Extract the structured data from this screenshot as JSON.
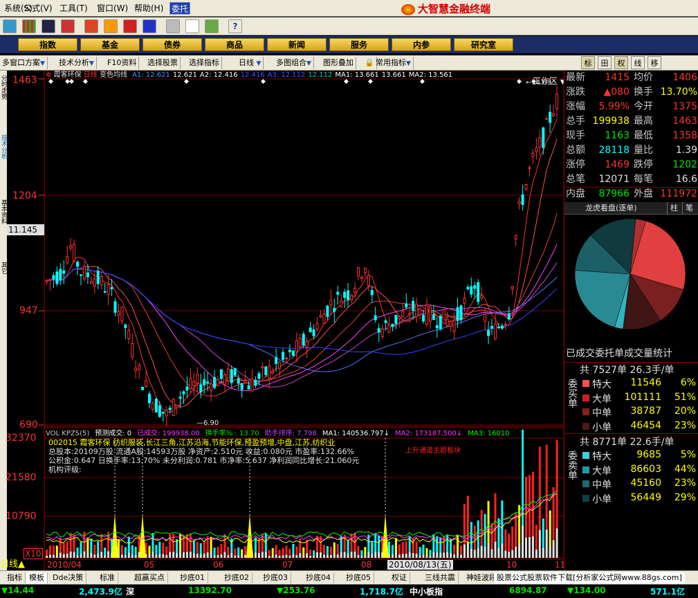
{
  "menu": {
    "items": [
      "系统(S)",
      "公式(V)",
      "工具(T)",
      "窗口(W)",
      "帮助(H)",
      "委托"
    ],
    "brand": "大智慧金融终端"
  },
  "nav": {
    "items": [
      "指数",
      "基金",
      "债券",
      "商品",
      "新闻",
      "服务",
      "内参",
      "研究室"
    ],
    "workspace": "工作区"
  },
  "subbar": {
    "items": [
      "多窗口方案",
      "技术分析",
      "F10资料",
      "选择股票",
      "选择指标",
      "日线",
      "多图组合",
      "图形叠加",
      "常用指标"
    ],
    "right_tabs": [
      "标",
      "田",
      "权",
      "线",
      "移"
    ]
  },
  "left_tabs": [
    "分时走势",
    "技术分析",
    "基本资料",
    "其它"
  ],
  "price_chart": {
    "title": "霞客环保",
    "period": "日线",
    "indicator": "变色均线",
    "legend": [
      {
        "label": "A1:",
        "value": "12.621",
        "color": "#4a90ff"
      },
      {
        "label": "",
        "value": "12.621",
        "color": "#ffffff"
      },
      {
        "label": "A2:",
        "value": "12.416",
        "color": "#ffffff"
      },
      {
        "label": "",
        "value": "12.416",
        "color": "#3a56ff"
      },
      {
        "label": "A3:",
        "value": "12.112",
        "color": "#3a56ff"
      },
      {
        "label": "",
        "value": "12.112",
        "color": "#00c8c8"
      },
      {
        "label": "MA1:",
        "value": "13.661",
        "color": "#ffffff"
      },
      {
        "label": "",
        "value": "13.661",
        "color": "#ffffff"
      },
      {
        "label": "MA2:",
        "value": "13.561",
        "color": "#ffffff"
      }
    ],
    "y_ticks": [
      "1463",
      "1204",
      "947",
      "690"
    ],
    "current_price_label": "11.145",
    "low_label": "6.90",
    "high_label": "14.63"
  },
  "volume_chart": {
    "header": [
      {
        "text": "VOL KPZS(5)",
        "color": "#c8c8c8"
      },
      {
        "text": "预测成交: 0",
        "color": "#ffffff"
      },
      {
        "text": "已成交: 199938.00",
        "color": "#ff33ff"
      },
      {
        "text": "换手率% : 13.70",
        "color": "#00e600"
      },
      {
        "text": "助手排序: 7.798",
        "color": "#c040ff"
      },
      {
        "text": "MA1: 140536.797↓",
        "color": "#ffffff"
      },
      {
        "text": "MA2: 173187.500↓",
        "color": "#ff33ff"
      },
      {
        "text": "MA3: 16010",
        "color": "#00ff00"
      }
    ],
    "info": [
      "002015  霞客环保 纺织服装,长江三角,江苏沿海,节能环保,预盈预增,中盘,江苏,纺织业",
      "总股本:20109万股 流通A股:14593万股  净资产:2.510元  收益:0.080元  市盈率:132.66%",
      "公积金:0.647  日换手率:13.70%  未分利润:0.781  市净率:5.637  净利润同比增长:21.060元",
      "机构评级:"
    ],
    "annotation": "上升通道主题板块",
    "y_ticks": [
      "32370",
      "21580",
      "10790"
    ],
    "multiplier": "X10",
    "x_labels": [
      "2010/04",
      "05",
      "06",
      "07",
      "08",
      "2010/08/13(五)",
      "10",
      "11"
    ]
  },
  "quote": {
    "rows": [
      {
        "l1": "最新",
        "v1": "1415",
        "c1": "red",
        "l2": "均价",
        "v2": "1406",
        "c2": "red"
      },
      {
        "l1": "涨跌",
        "v1": "▲080",
        "c1": "red",
        "l2": "换手",
        "v2": "13.70%",
        "c2": "yellow"
      },
      {
        "l1": "涨幅",
        "v1": "5.99%",
        "c1": "red",
        "l2": "今开",
        "v2": "1375",
        "c2": "red"
      },
      {
        "l1": "总手",
        "v1": "199938",
        "c1": "yellow",
        "l2": "最高",
        "v2": "1463",
        "c2": "red"
      },
      {
        "l1": "现手",
        "v1": "1163",
        "c1": "green",
        "l2": "最低",
        "v2": "1358",
        "c2": "red"
      },
      {
        "l1": "总额",
        "v1": "28118",
        "c1": "cyan",
        "l2": "量比",
        "v2": "1.39",
        "c2": "white"
      },
      {
        "l1": "涨停",
        "v1": "1469",
        "c1": "red",
        "l2": "跌停",
        "v2": "1202",
        "c2": "green"
      },
      {
        "l1": "总笔",
        "v1": "12071",
        "c1": "white",
        "l2": "每笔",
        "v2": "16.6",
        "c2": "white"
      },
      {
        "l1": "内盘",
        "v1": "87966",
        "c1": "green",
        "l2": "外盘",
        "v2": "111972",
        "c2": "red"
      }
    ],
    "tabs": [
      "龙虎看盘(逐单)",
      "柱",
      "笔"
    ],
    "pie": [
      {
        "value": 6,
        "color": "#b03030"
      },
      {
        "value": 51,
        "color": "#e04040"
      },
      {
        "value": 23,
        "color": "#7a2020"
      },
      {
        "value": 23,
        "color": "#401515"
      },
      {
        "value": 5,
        "color": "#33b3bf"
      },
      {
        "value": 44,
        "color": "#2a8a94"
      },
      {
        "value": 23,
        "color": "#1d5f66"
      },
      {
        "value": 29,
        "color": "#103a3e"
      }
    ],
    "stat_title": "已成交委托单成交量统计",
    "buy": {
      "side": "委买单",
      "total": "共  7527单  26.3手/单",
      "rows": [
        {
          "name": "特大",
          "vol": "11546",
          "pct": "6%",
          "color": "#ff5050"
        },
        {
          "name": "大单",
          "vol": "101111",
          "pct": "51%",
          "color": "#cc2020"
        },
        {
          "name": "中单",
          "vol": "38787",
          "pct": "20%",
          "color": "#882020"
        },
        {
          "name": "小单",
          "vol": "46454",
          "pct": "23%",
          "color": "#501818"
        }
      ]
    },
    "sell": {
      "side": "委卖单",
      "total": "共  8771单  22.6手/单",
      "rows": [
        {
          "name": "特大",
          "vol": "9685",
          "pct": "5%",
          "color": "#40d0d8"
        },
        {
          "name": "大单",
          "vol": "86603",
          "pct": "44%",
          "color": "#289aa2"
        },
        {
          "name": "中单",
          "vol": "45160",
          "pct": "23%",
          "color": "#1c6a70"
        },
        {
          "name": "小单",
          "vol": "56449",
          "pct": "29%",
          "color": "#124044"
        }
      ]
    }
  },
  "bottom": {
    "items": [
      "指标",
      "模板",
      "Dde决策",
      "标准",
      "超赢买点",
      "抄底01",
      "抄底02",
      "抄底03",
      "抄底04",
      "抄底05",
      "权证",
      "三线共震",
      "神娃波段"
    ],
    "ad": "股票公式股票软件下载[分析家公式网www.88gs.com]",
    "period": "日线"
  },
  "status": {
    "items": [
      {
        "text": "▼14.44",
        "color": "#00e600"
      },
      {
        "text": "2,473.9亿",
        "color": "#00ffff"
      },
      {
        "text": "深",
        "color": "#ffffff"
      },
      {
        "text": "13392.70",
        "color": "#00e600"
      },
      {
        "text": "▼253.76",
        "color": "#00e600"
      },
      {
        "text": "1,718.7亿",
        "color": "#00ffff"
      },
      {
        "text": "中小板指",
        "color": "#ffffff"
      },
      {
        "text": "6894.87",
        "color": "#00e600"
      },
      {
        "text": "▼134.00",
        "color": "#00e600"
      },
      {
        "text": "571.1亿",
        "color": "#00ffff"
      }
    ]
  }
}
